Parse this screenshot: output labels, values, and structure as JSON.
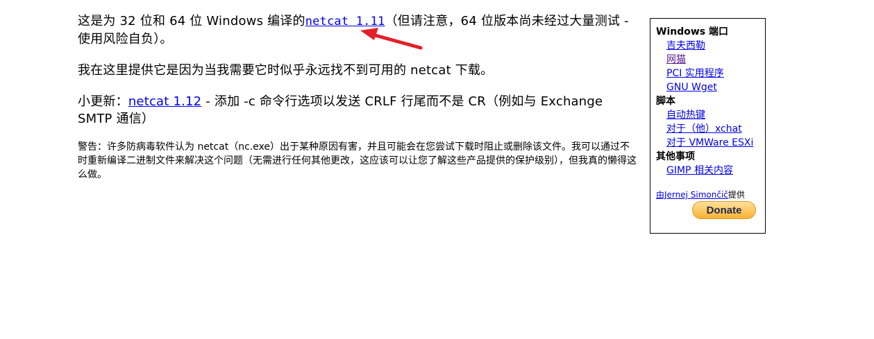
{
  "main": {
    "p1": {
      "before": "这是为 32 位和 64 位 Windows 编译的",
      "link": "netcat 1.11",
      "after": "（但请注意，64 位版本尚未经过大量测试 - 使用风险自负）。"
    },
    "p2": "我在这里提供它是因为当我需要它时似乎永远找不到可用的 netcat 下载。",
    "p3": {
      "before": "小更新：",
      "link": "netcat 1.12",
      "after": " - 添加 -c 命令行选项以发送 CRLF 行尾而不是 CR（例如与 Exchange SMTP 通信）"
    },
    "warning": "警告：许多防病毒软件认为 netcat（nc.exe）出于某种原因有害，并且可能会在您尝试下载时阻止或删除该文件。我可以通过不时重新编译二进制文件来解决这个问题（无需进行任何其他更改，这应该可以让您了解这些产品提供的保护级别），但我真的懒得这么做。"
  },
  "sidebar": {
    "section1": {
      "title": "Windows 端口",
      "items": [
        "吉夫西勒",
        "网猫",
        "PCI 实用程序",
        "GNU Wget"
      ]
    },
    "section2": {
      "title": "脚本",
      "items": [
        "自动热键",
        "对于（他）xchat",
        "对于 VMWare ESXi"
      ]
    },
    "section3": {
      "title": "其他事项",
      "items": [
        "GIMP 相关内容"
      ]
    },
    "credit": {
      "link": "由Jernej Simončič",
      "suffix": "提供"
    },
    "donate_label": "Donate"
  },
  "colors": {
    "link": "#0000ee",
    "visited": "#551a8b",
    "arrow": "#e3202a",
    "donate": "#f9b233"
  }
}
